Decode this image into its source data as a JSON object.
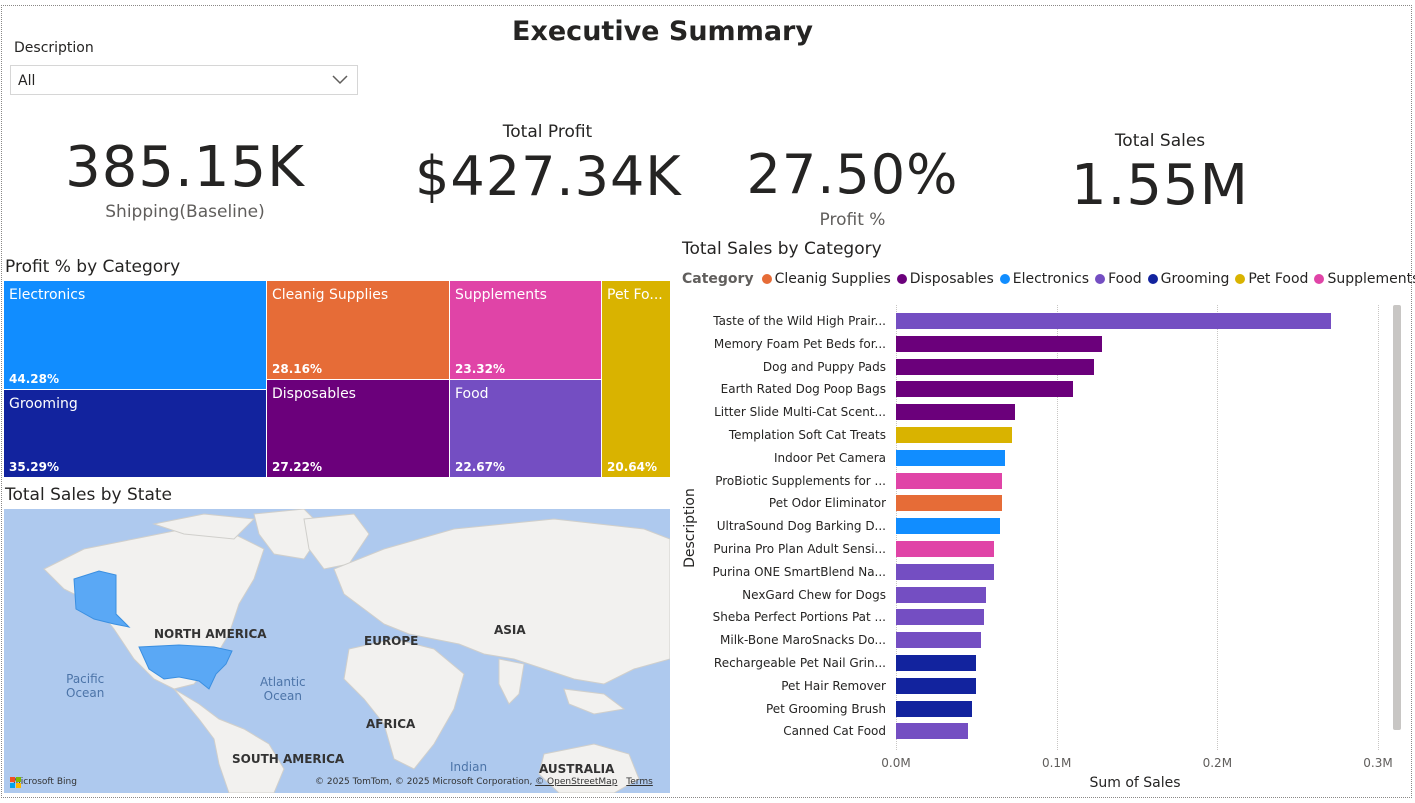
{
  "title": "Executive Summary",
  "slicer": {
    "label": "Description",
    "value": "All"
  },
  "kpis": {
    "shipping": {
      "value": "385.15K",
      "label": "Shipping(Baseline)"
    },
    "profit": {
      "title": "Total Profit",
      "value": "$427.34K"
    },
    "profit_pct": {
      "value": "27.50%",
      "label": "Profit %"
    },
    "sales": {
      "title": "Total Sales",
      "value": "1.55M"
    }
  },
  "treemap": {
    "title": "Profit % by Category",
    "tiles": [
      {
        "name": "Electronics",
        "pct": "44.28%",
        "color": "#118dff"
      },
      {
        "name": "Grooming",
        "pct": "35.29%",
        "color": "#12239e"
      },
      {
        "name": "Cleanig Supplies",
        "pct": "28.16%",
        "color": "#e66c37"
      },
      {
        "name": "Disposables",
        "pct": "27.22%",
        "color": "#6b007b"
      },
      {
        "name": "Supplements",
        "pct": "23.32%",
        "color": "#e044a7"
      },
      {
        "name": "Food",
        "pct": "22.67%",
        "color": "#744ec2"
      },
      {
        "name": "Pet Fo...",
        "pct": "20.64%",
        "color": "#d9b300"
      }
    ]
  },
  "map": {
    "title": "Total Sales by State",
    "labels": {
      "north_america": "NORTH AMERICA",
      "europe": "EUROPE",
      "asia": "ASIA",
      "africa": "AFRICA",
      "south_america": "SOUTH AMERICA",
      "australia": "AUSTRALIA",
      "pacific": "Pacific",
      "pacific2": "Ocean",
      "atlantic": "Atlantic",
      "atlantic2": "Ocean",
      "indian": "Indian"
    },
    "brand": "Microsoft Bing",
    "copyright": "© 2025 TomTom, © 2025 Microsoft Corporation, ",
    "osm": "© OpenStreetMap",
    "terms": "Terms"
  },
  "bar_chart": {
    "title": "Total Sales by Category",
    "legend_title": "Category",
    "ylabel": "Description",
    "xlabel": "Sum of Sales",
    "ticks": [
      "0.0M",
      "0.1M",
      "0.2M",
      "0.3M"
    ],
    "legend": [
      {
        "name": "Cleanig Supplies",
        "color": "#e66c37"
      },
      {
        "name": "Disposables",
        "color": "#6b007b"
      },
      {
        "name": "Electronics",
        "color": "#118dff"
      },
      {
        "name": "Food",
        "color": "#744ec2"
      },
      {
        "name": "Grooming",
        "color": "#12239e"
      },
      {
        "name": "Pet Food",
        "color": "#d9b300"
      },
      {
        "name": "Supplements",
        "color": "#e044a7"
      }
    ]
  },
  "chart_data": {
    "type": "bar",
    "orientation": "horizontal",
    "title": "Total Sales by Category",
    "xlabel": "Sum of Sales",
    "ylabel": "Description",
    "xlim": [
      0,
      0.3
    ],
    "x_unit": "M",
    "categories": [
      "Taste of the Wild High Prair...",
      "Memory Foam Pet Beds for...",
      "Dog and Puppy Pads",
      "Earth Rated Dog Poop Bags",
      "Litter Slide Multi-Cat Scent...",
      "Templation Soft Cat Treats",
      "Indoor Pet Camera",
      "ProBiotic Supplements for ...",
      "Pet Odor Eliminator",
      "UltraSound Dog Barking D...",
      "Purina Pro Plan Adult Sensi...",
      "Purina ONE SmartBlend Na...",
      "NexGard Chew for Dogs",
      "Sheba Perfect Portions Pat ...",
      "Milk-Bone MaroSnacks Do...",
      "Rechargeable Pet Nail Grin...",
      "Pet Hair Remover",
      "Pet Grooming Brush",
      "Canned Cat Food"
    ],
    "values": [
      0.271,
      0.128,
      0.123,
      0.11,
      0.074,
      0.072,
      0.068,
      0.066,
      0.066,
      0.065,
      0.061,
      0.061,
      0.056,
      0.055,
      0.053,
      0.05,
      0.05,
      0.047,
      0.045
    ],
    "series_category": [
      "Food",
      "Disposables",
      "Disposables",
      "Disposables",
      "Disposables",
      "Pet Food",
      "Electronics",
      "Supplements",
      "Cleanig Supplies",
      "Electronics",
      "Supplements",
      "Food",
      "Food",
      "Food",
      "Food",
      "Grooming",
      "Grooming",
      "Grooming",
      "Food"
    ],
    "grid": true,
    "legend_position": "top"
  }
}
